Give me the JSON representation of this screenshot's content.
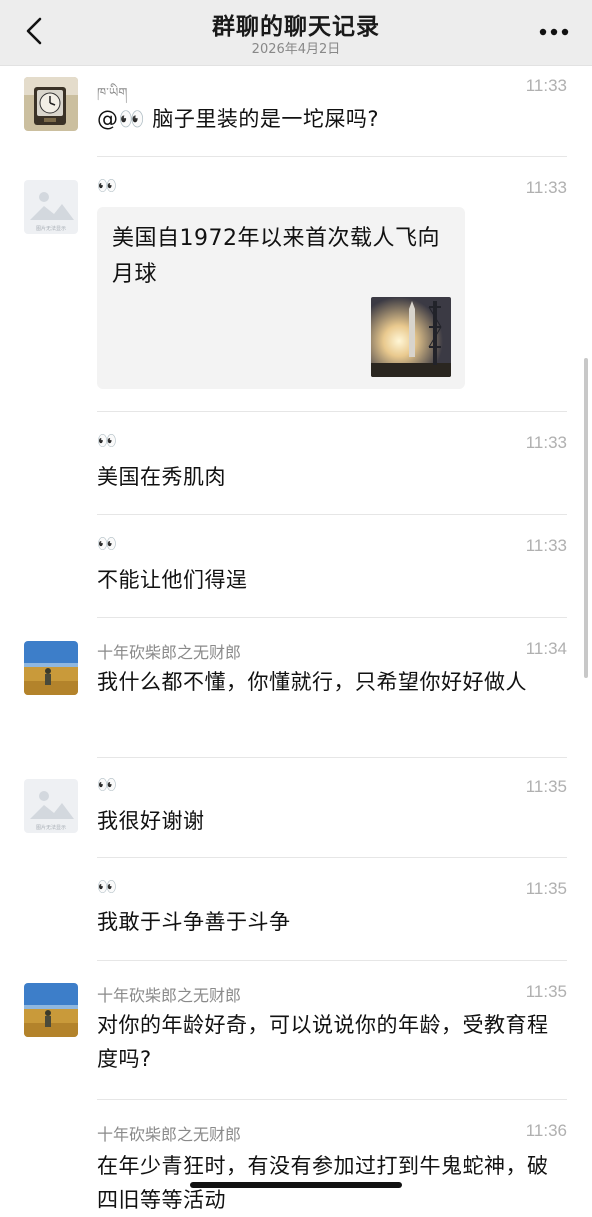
{
  "header": {
    "title": "群聊的聊天记录",
    "date": "2026年4月2日",
    "back_icon": "chevron-left-icon",
    "more_icon": "ellipsis-icon"
  },
  "messages": [
    {
      "name": "ཁ་ཡིག",
      "time": "11:33",
      "text": "@👀 脑子里装的是一坨屎吗?",
      "avatar": "clock-photo-avatar"
    },
    {
      "name": "👀",
      "time": "11:33",
      "avatar": "placeholder-image-avatar",
      "card": {
        "title": "美国自1972年以来首次载人飞向月球",
        "thumb": "rocket-launch-thumbnail"
      }
    },
    {
      "name": "👀",
      "time": "11:33",
      "text": "美国在秀肌肉"
    },
    {
      "name": "👀",
      "time": "11:33",
      "text": "不能让他们得逞"
    },
    {
      "name": "十年砍柴郎之无财郎",
      "time": "11:34",
      "text": "我什么都不懂，你懂就行，只希望你好好做人",
      "avatar": "wheat-field-avatar"
    },
    {
      "name": "👀",
      "time": "11:35",
      "text": "我很好谢谢",
      "avatar": "placeholder-image-avatar"
    },
    {
      "name": "👀",
      "time": "11:35",
      "text": "我敢于斗争善于斗争"
    },
    {
      "name": "十年砍柴郎之无财郎",
      "time": "11:35",
      "text": "对你的年龄好奇，可以说说你的年龄，受教育程度吗?",
      "avatar": "wheat-field-avatar"
    },
    {
      "name": "十年砍柴郎之无财郎",
      "time": "11:36",
      "text": "在年少青狂时，有没有参加过打到牛鬼蛇神，破四旧等等活动"
    }
  ],
  "placeholder_avatar_caption": "图片无法显示"
}
